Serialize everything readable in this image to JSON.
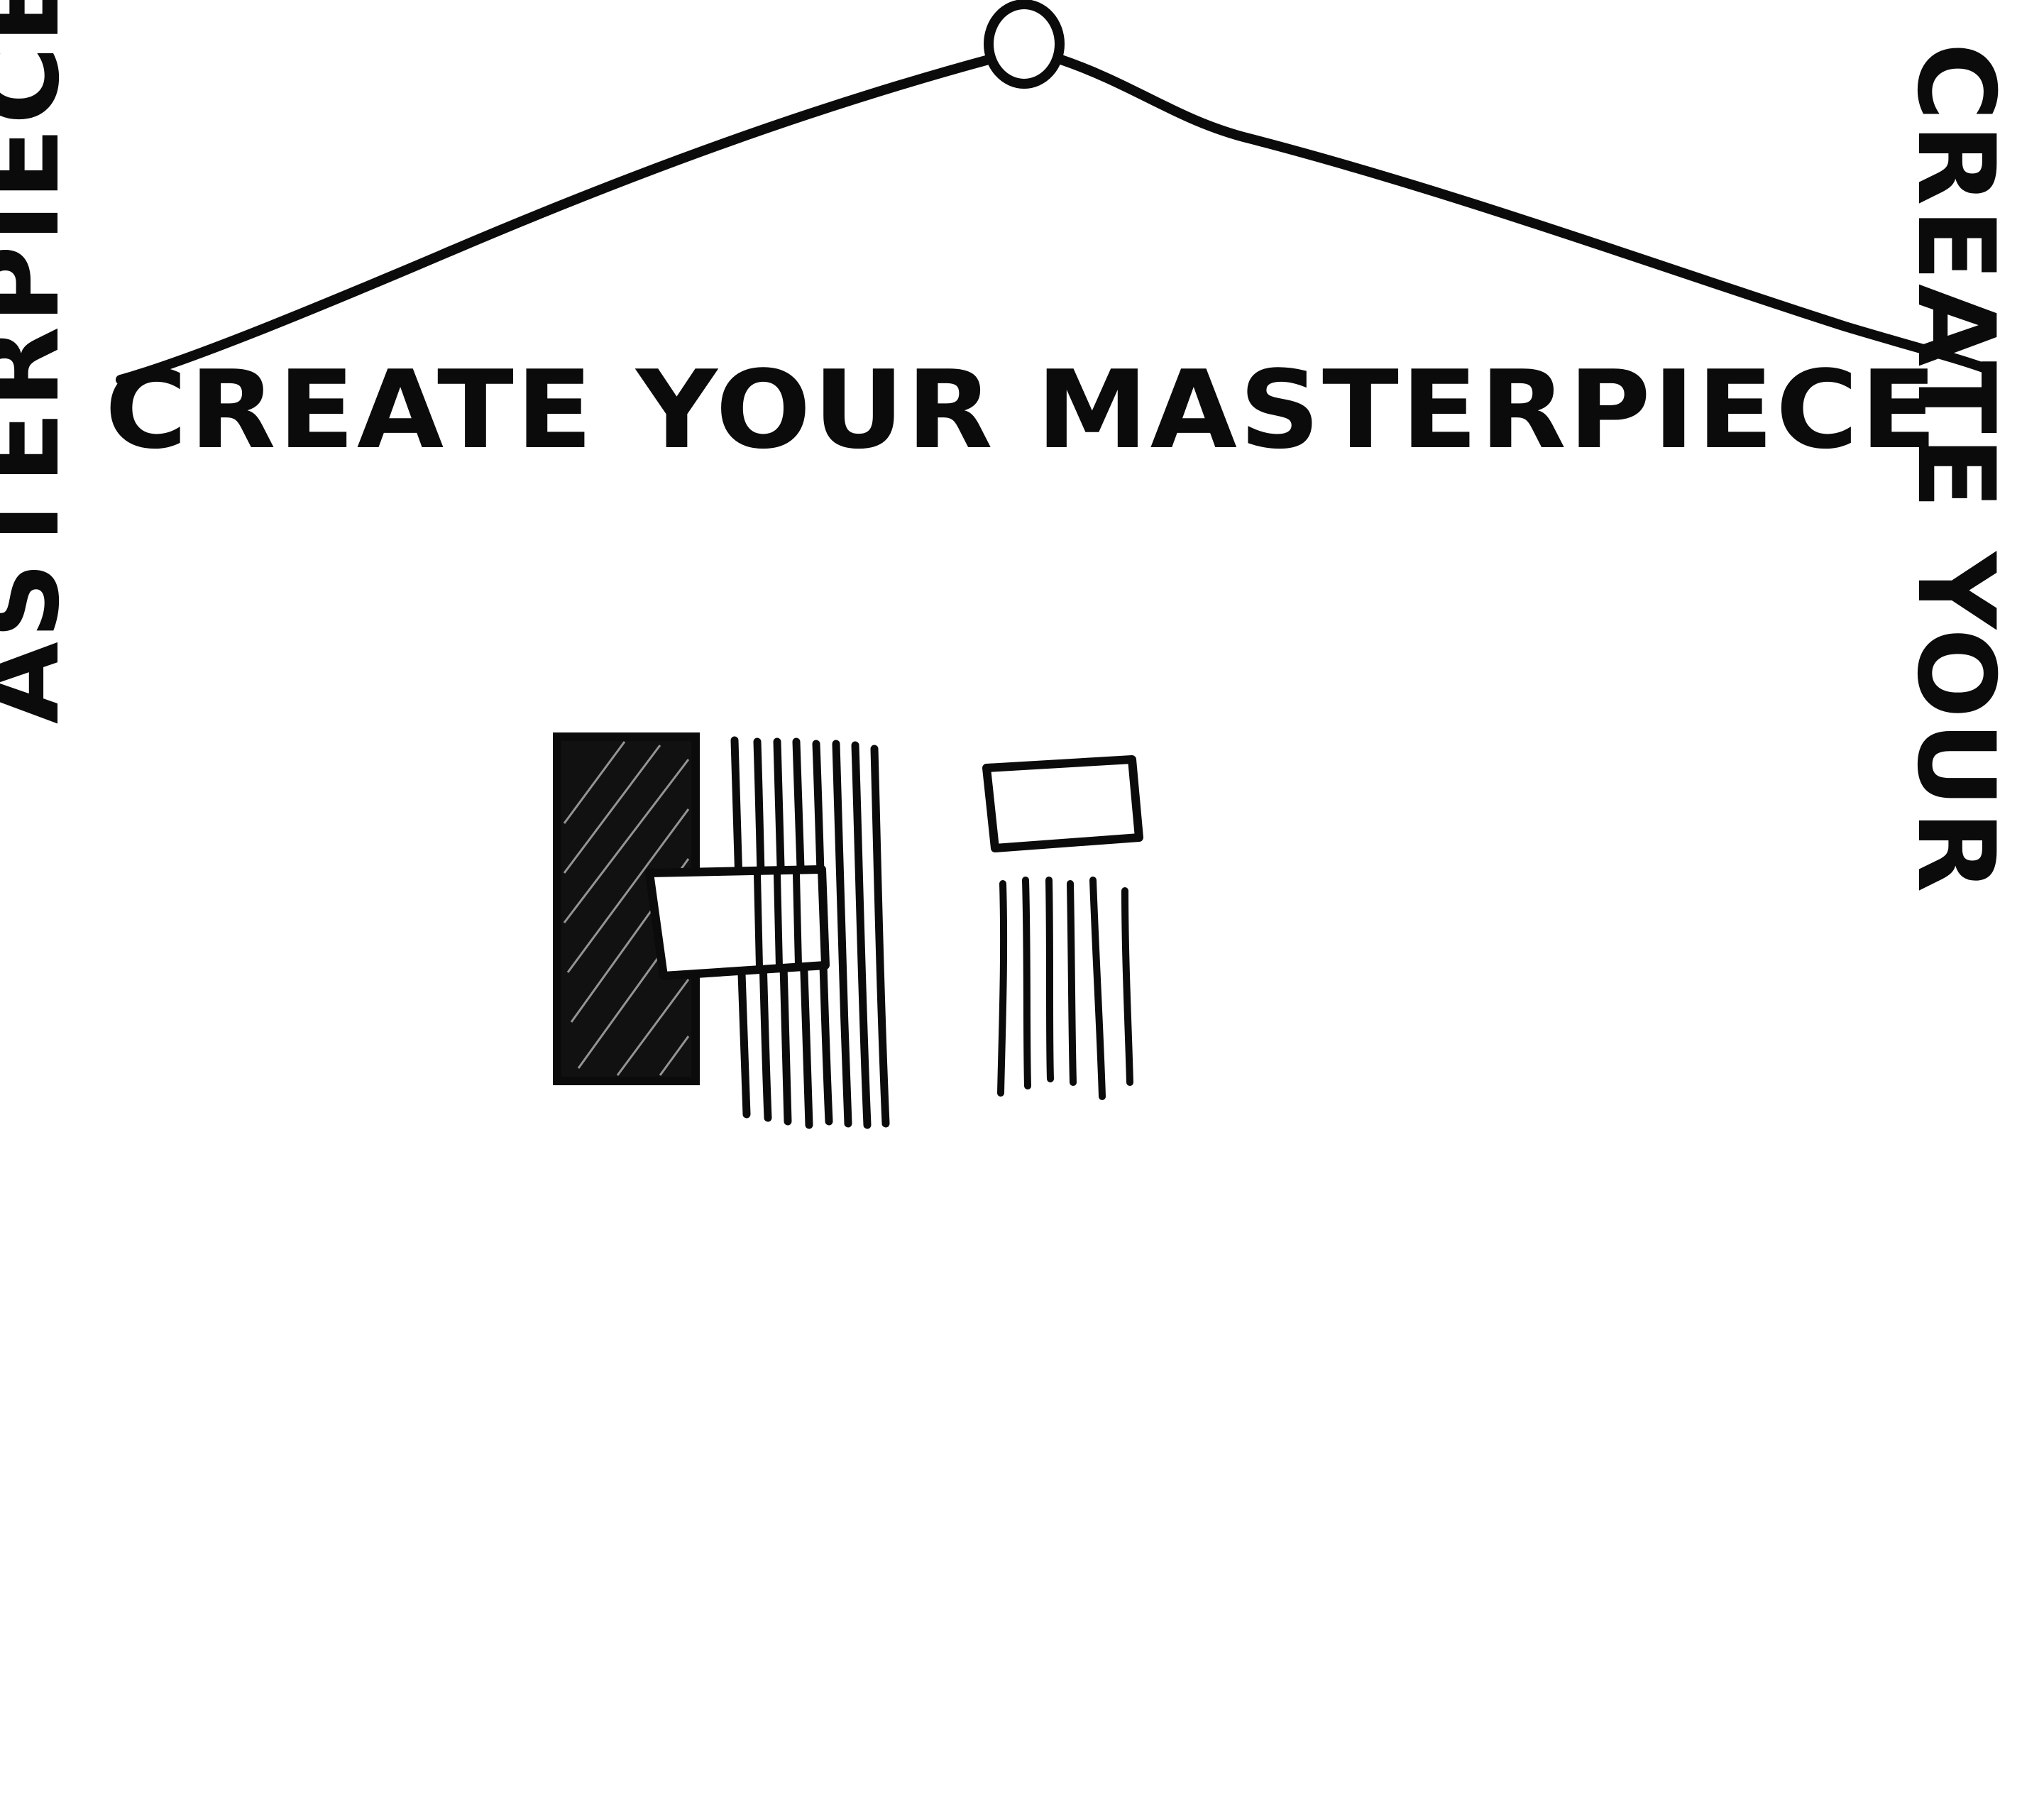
{
  "banner": {
    "top_text": "CREATE YOUR MASTERPIECE",
    "left_side_text": "ASTERPIECE",
    "right_side_text": "CREATE YOUR"
  },
  "colors": {
    "ink": "#0b0b0b",
    "paper": "#ffffff"
  }
}
